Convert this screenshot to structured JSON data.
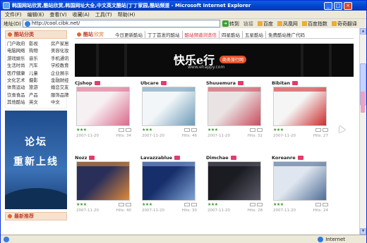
{
  "window": {
    "title": "韩国网站欣赏,酷站欣赏,韩国网址大全,中文英文酷站|丁丁家园,酷站频道 - Microsoft Internet Explorer",
    "buttons": [
      "_",
      "□",
      "×"
    ]
  },
  "menu": [
    "文件(F)",
    "编辑(E)",
    "查看(V)",
    "收藏(A)",
    "工具(T)",
    "帮助(H)"
  ],
  "toolbar": {
    "address_label": "地址(D)",
    "address_value": "http://cool.cibk.net/",
    "go_label": "转到",
    "links_label": "链接",
    "links": [
      "百度",
      "凤凰网",
      "百度指数",
      "奇奇翻译"
    ]
  },
  "sidebar": {
    "heading": "酷站分类",
    "categories": [
      "门户政府",
      "影视",
      "房产家居",
      "电脑网络",
      "购物",
      "美容化妆",
      "游戏娱乐",
      "音乐",
      "手机通讯",
      "生活时尚",
      "汽车",
      "学校教育",
      "医疗健康",
      "儿童",
      "企业展示",
      "文化艺术",
      "摄影",
      "金融财经",
      "体育运动",
      "旅游",
      "婚恋交友",
      "饮食食品",
      "产品",
      "服饰品牌",
      "其他酷站",
      "英文",
      "中文"
    ],
    "forum_banner_line1": "论坛",
    "forum_banner_line2": "重新上线",
    "second_heading": "最新推荐"
  },
  "main": {
    "tab_heading": "酷站",
    "tab_heading_sub": "欣赏",
    "tabs": [
      "今日更新酷站",
      "丁丁首发的酷站",
      "酷站频道浏览信",
      "四星酷站",
      "五星酷站",
      "免费酷站推广代码"
    ],
    "banner": {
      "logo": "快乐e行",
      "url": "www.ehappy.com",
      "tag": "商务旅行网"
    }
  },
  "cards": [
    {
      "name": "Cjshop",
      "date": "2007-11-20",
      "hits": "Hits: 34",
      "stars": "★★★",
      "colors": [
        "#f7f0f3",
        "#d96a8a"
      ]
    },
    {
      "name": "Ubcare",
      "date": "2007-11-20",
      "hits": "Hits: 46",
      "stars": "★★★",
      "colors": [
        "#f2f6f8",
        "#6d9ab8"
      ]
    },
    {
      "name": "Shuuemura",
      "date": "2007-11-20",
      "hits": "Hits: 32",
      "stars": "★★★",
      "colors": [
        "#eae3e3",
        "#c84d5e"
      ]
    },
    {
      "name": "Bibitan",
      "date": "2007-11-20",
      "hits": "Hits: 27",
      "stars": "★★★",
      "colors": [
        "#f5f5f5",
        "#cc2c2c"
      ]
    },
    {
      "name": "Nozz",
      "date": "2007-11-20",
      "hits": "Hits: 40",
      "stars": "★★★",
      "colors": [
        "#2a2f5a",
        "#e08a3a"
      ]
    },
    {
      "name": "Lavazzablue",
      "date": "2007-11-20",
      "hits": "Hits: 30",
      "stars": "★★★",
      "colors": [
        "#162e6a",
        "#7fa3d6"
      ]
    },
    {
      "name": "Dimchae",
      "date": "2007-11-20",
      "hits": "Hits: 28",
      "stars": "★★★",
      "colors": [
        "#1b1b22",
        "#5c5c6a"
      ]
    },
    {
      "name": "Koreanre",
      "date": "2007-11-20",
      "hits": "Hits: 24",
      "stars": "★★★",
      "colors": [
        "#dfe6ef",
        "#4f6d96"
      ]
    }
  ],
  "status": {
    "zone": "Internet"
  }
}
